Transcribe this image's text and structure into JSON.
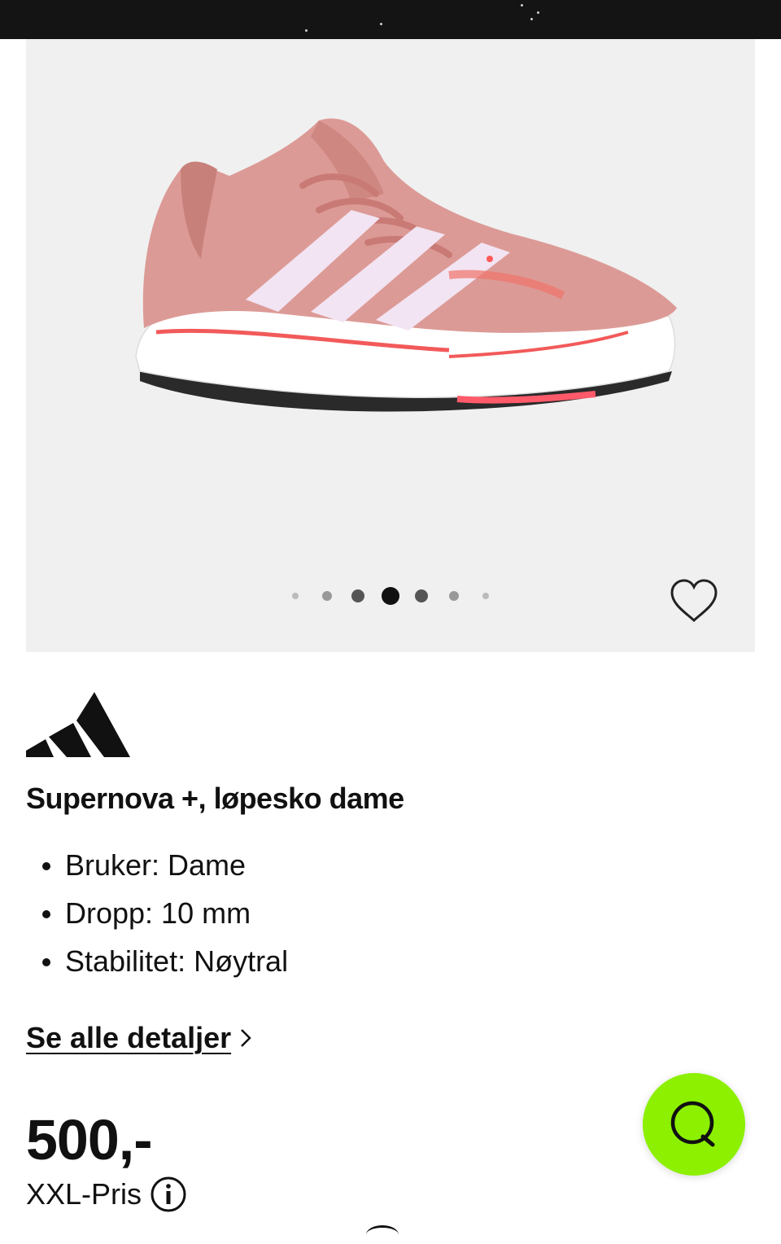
{
  "product": {
    "title": "Supernova +, løpesko dame",
    "features": [
      "Bruker: Dame",
      "Dropp: 10 mm",
      "Stabilitet: Nøytral"
    ],
    "details_link": "Se alle detaljer",
    "price": "500,-",
    "price_label": "XXL-Pris"
  },
  "gallery": {
    "image_count": 7,
    "active_index": 3
  },
  "icons": {
    "favorite": "heart-outline-icon",
    "chevron": "chevron-right-icon",
    "info": "info-circle-icon",
    "chat": "chat-bubble-icon",
    "brand": "adidas-logo"
  },
  "colors": {
    "chat_button": "#8cf000",
    "gallery_bg": "#f0f0f0",
    "top_bar": "#141414"
  }
}
